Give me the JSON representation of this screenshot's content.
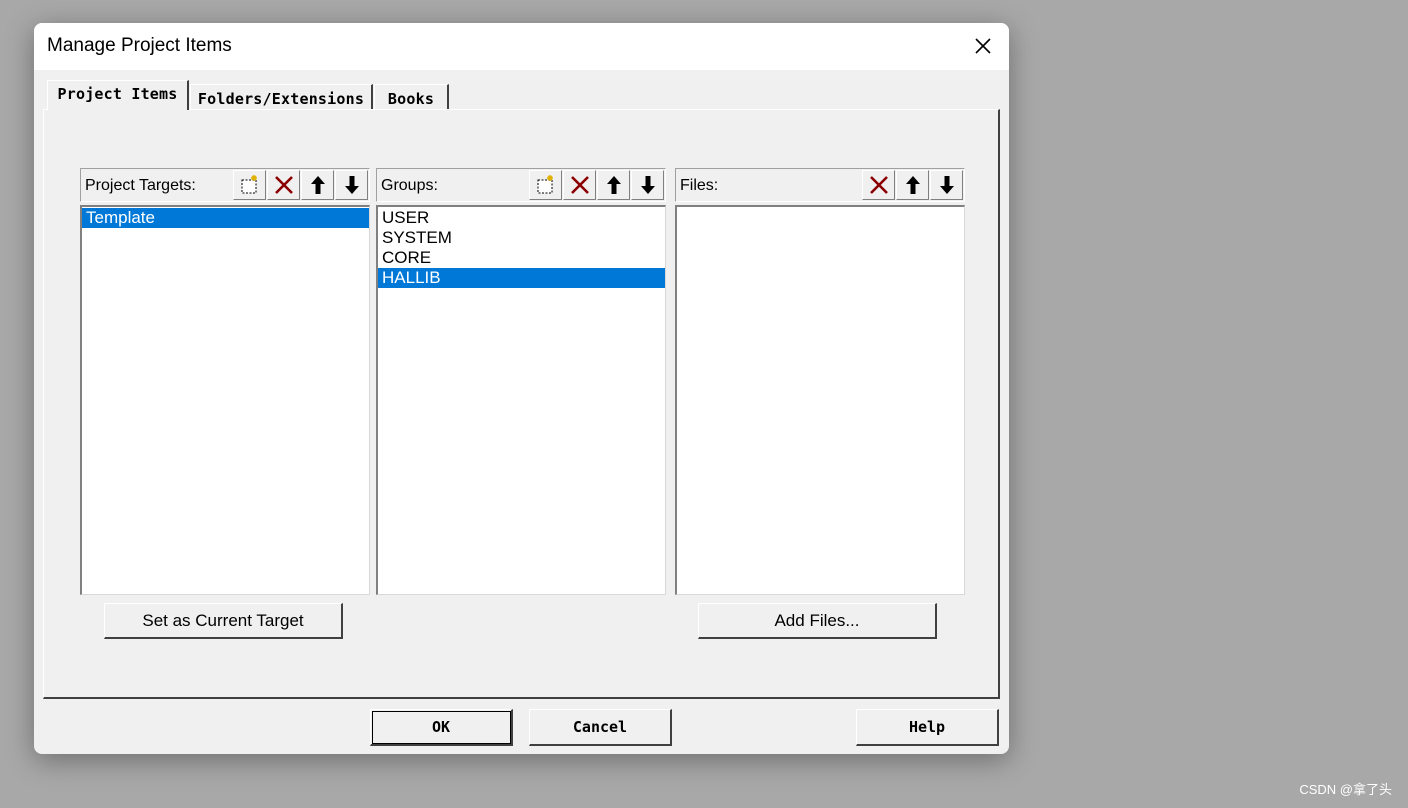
{
  "dialog": {
    "title": "Manage Project Items"
  },
  "tabs": [
    {
      "label": "Project Items",
      "active": true
    },
    {
      "label": "Folders/Extensions",
      "active": false
    },
    {
      "label": "Books",
      "active": false
    }
  ],
  "targets": {
    "label": "Project Targets:",
    "items": [
      {
        "text": "Template",
        "selected": true
      }
    ],
    "button": "Set as Current Target"
  },
  "groups": {
    "label": "Groups:",
    "items": [
      {
        "text": "USER",
        "selected": false
      },
      {
        "text": "SYSTEM",
        "selected": false
      },
      {
        "text": "CORE",
        "selected": false
      },
      {
        "text": "HALLIB",
        "selected": true
      }
    ]
  },
  "files": {
    "label": "Files:",
    "items": [],
    "button": "Add Files..."
  },
  "footer": {
    "ok": "OK",
    "cancel": "Cancel",
    "help": "Help"
  },
  "icons": {
    "new": "new-item-icon",
    "delete": "delete-icon",
    "up": "move-up-icon",
    "down": "move-down-icon",
    "close": "close-icon"
  },
  "colors": {
    "selection": "#0078d7",
    "delete": "#8b0000",
    "background": "#a8a8a8"
  },
  "watermark": "CSDN @拿了头"
}
